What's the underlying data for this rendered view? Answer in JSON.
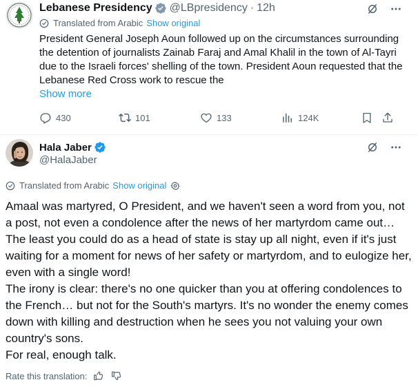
{
  "tweet1": {
    "display_name": "Lebanese Presidency",
    "handle": "@LBpresidency",
    "separator": "·",
    "time": "12h",
    "translated_label": "Translated from Arabic",
    "show_original": "Show original",
    "body": "President General Joseph Aoun followed up on the circumstances surrounding the detention of journalists Zainab Faraj and Amal Khalil in the town of Al-Tayri due to the Israeli forces' shelling of the town. President Aoun requested that the Lebanese Red Cross work to rescue the",
    "show_more": "Show more",
    "replies": "430",
    "reposts": "101",
    "likes": "133",
    "views": "124K",
    "icons": {
      "avatar": "lebanese-presidency-seal",
      "verified": "gray-verified-badge",
      "grok": "grok-icon",
      "more": "more-icon",
      "reply": "reply-icon",
      "repost": "repost-icon",
      "like": "like-icon",
      "views": "views-icon",
      "bookmark": "bookmark-icon",
      "share": "share-icon"
    }
  },
  "tweet2": {
    "display_name": "Hala Jaber",
    "handle": "@HalaJaber",
    "translated_label": "Translated from Arabic",
    "show_original": "Show original",
    "paragraphs": [
      "Amaal was martyred, O President, and we haven't seen a word from you, not a post, not even a condolence after the news of her martyrdom came out… The least you could do as a head of state is stay up all night, even if it's just waiting for a moment for news of her safety or martyrdom, and to eulogize her, even with a single word!",
      "The irony is clear: there's no one quicker than you at offering condolences to the French… but not for the South's martyrs. It's no wonder the enemy comes down with killing and destruction when he sees you not valuing your own country's sons.",
      "For real, enough talk."
    ],
    "rate_label": "Rate this translation:",
    "icons": {
      "avatar": "profile-photo",
      "verified": "blue-verified-badge",
      "grok": "grok-icon",
      "more": "more-icon",
      "settings": "gear-icon",
      "thumbs_up": "thumbs-up-icon",
      "thumbs_down": "thumbs-down-icon"
    }
  },
  "colors": {
    "accent": "#1d9bf0",
    "muted_text": "#536471",
    "primary_text": "#0f1419",
    "divider": "#eff3f4"
  }
}
